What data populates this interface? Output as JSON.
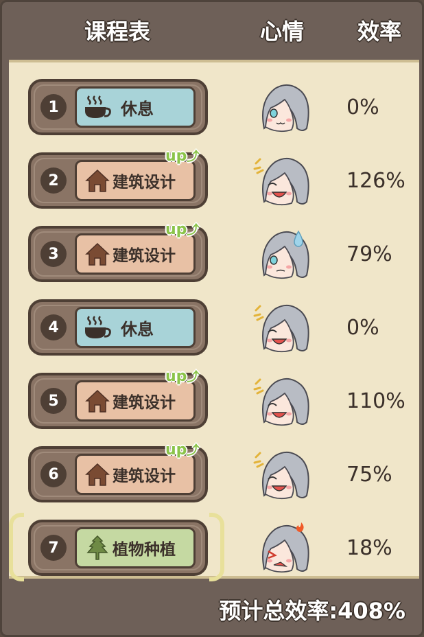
{
  "header": {
    "schedule": "课程表",
    "mood": "心情",
    "efficiency": "效率"
  },
  "rows": [
    {
      "num": "1",
      "course": "休息",
      "type": "rest",
      "icon": "cup-icon",
      "up": "",
      "mood": "calm",
      "eff": "0%"
    },
    {
      "num": "2",
      "course": "建筑设计",
      "type": "arch",
      "icon": "house-icon",
      "up": "up",
      "mood": "happy",
      "eff": "126%"
    },
    {
      "num": "3",
      "course": "建筑设计",
      "type": "arch",
      "icon": "house-icon",
      "up": "up",
      "mood": "sweat",
      "eff": "79%"
    },
    {
      "num": "4",
      "course": "休息",
      "type": "rest",
      "icon": "cup-icon",
      "up": "",
      "mood": "happy",
      "eff": "0%"
    },
    {
      "num": "5",
      "course": "建筑设计",
      "type": "arch",
      "icon": "house-icon",
      "up": "up",
      "mood": "happy",
      "eff": "110%"
    },
    {
      "num": "6",
      "course": "建筑设计",
      "type": "arch",
      "icon": "house-icon",
      "up": "up",
      "mood": "happy",
      "eff": "75%"
    },
    {
      "num": "7",
      "course": "植物种植",
      "type": "plant",
      "icon": "leaf-icon",
      "up": "",
      "mood": "angry",
      "eff": "18%",
      "selected": true
    }
  ],
  "footer": {
    "total": "预计总效率:408%"
  },
  "colors": {
    "rest": "#a8d3d8",
    "arch": "#e8c1a5",
    "plant": "#c5d9a2",
    "up": "#8bc44a"
  }
}
